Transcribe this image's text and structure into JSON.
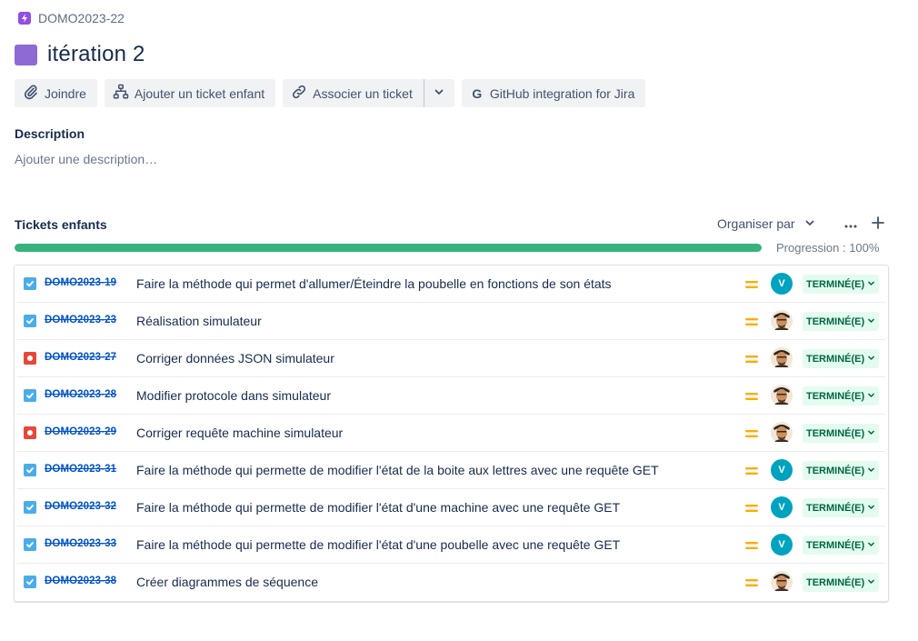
{
  "breadcrumb": {
    "parent_key": "DOMO2023-22"
  },
  "issue": {
    "title": "itération 2"
  },
  "toolbar": {
    "attach": "Joindre",
    "add_child": "Ajouter un ticket enfant",
    "link_issue": "Associer un ticket",
    "github": "GitHub integration for Jira"
  },
  "description": {
    "label": "Description",
    "placeholder": "Ajouter une description…"
  },
  "children": {
    "heading": "Tickets enfants",
    "organize_label": "Organiser par",
    "progress_label": "Progression : 100%",
    "progress_percent": 100,
    "items": [
      {
        "key": "DOMO2023-19",
        "summary": "Faire la méthode qui permet d'allumer/Éteindre la poubelle en fonctions de son états",
        "type": "task",
        "priority": "medium",
        "assignee": "V",
        "status": "TERMINÉ(E)"
      },
      {
        "key": "DOMO2023-23",
        "summary": "Réalisation simulateur",
        "type": "task",
        "priority": "medium",
        "assignee": "photo",
        "status": "TERMINÉ(E)"
      },
      {
        "key": "DOMO2023-27",
        "summary": "Corriger données JSON simulateur",
        "type": "bug",
        "priority": "medium",
        "assignee": "photo",
        "status": "TERMINÉ(E)"
      },
      {
        "key": "DOMO2023-28",
        "summary": "Modifier protocole dans simulateur",
        "type": "task",
        "priority": "medium",
        "assignee": "photo",
        "status": "TERMINÉ(E)"
      },
      {
        "key": "DOMO2023-29",
        "summary": "Corriger requête machine simulateur",
        "type": "bug",
        "priority": "medium",
        "assignee": "photo",
        "status": "TERMINÉ(E)"
      },
      {
        "key": "DOMO2023-31",
        "summary": "Faire la méthode qui permette de modifier l'état de la boite aux lettres avec une requête GET",
        "type": "task",
        "priority": "medium",
        "assignee": "V",
        "status": "TERMINÉ(E)"
      },
      {
        "key": "DOMO2023-32",
        "summary": "Faire la méthode qui permette de modifier l'état d'une machine avec une requête GET",
        "type": "task",
        "priority": "medium",
        "assignee": "V",
        "status": "TERMINÉ(E)"
      },
      {
        "key": "DOMO2023-33",
        "summary": "Faire la méthode qui permette de modifier l'état d'une poubelle avec une requête GET",
        "type": "task",
        "priority": "medium",
        "assignee": "V",
        "status": "TERMINÉ(E)"
      },
      {
        "key": "DOMO2023-38",
        "summary": "Créer diagrammes de séquence",
        "type": "task",
        "priority": "medium",
        "assignee": "photo",
        "status": "TERMINÉ(E)"
      }
    ]
  },
  "colors": {
    "epic": "#8e6ad4",
    "link": "#0052cc",
    "progress": "#36b37e",
    "task_icon": "#4bade8",
    "bug_icon": "#e5493a",
    "priority_medium": "#ffab00",
    "avatar_v": "#00a3bf",
    "status_done_bg": "#e3fcef",
    "status_done_text": "#006644"
  }
}
